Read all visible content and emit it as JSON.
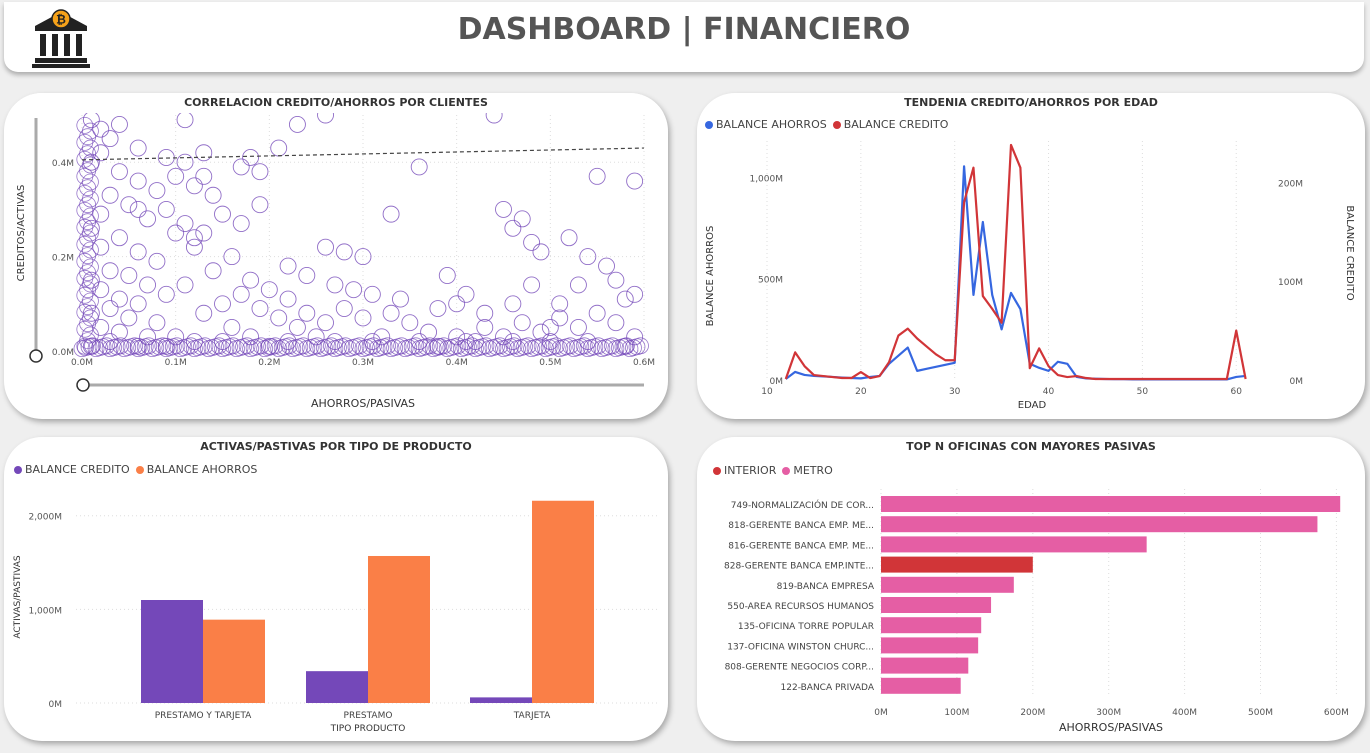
{
  "header": {
    "title": "DASHBOARD | FINANCIERO",
    "logo_icon": "bank-bitcoin-icon"
  },
  "colors": {
    "purple": "#7448b9",
    "orange": "#fa7f47",
    "blue": "#3667e0",
    "red": "#d13538",
    "pink": "#e55ea4",
    "darkred": "#d13538"
  },
  "panels": {
    "scatter": {
      "title": "CORRELACION CREDITO/AHORROS POR CLIENTES",
      "chart_data": {
        "type": "scatter",
        "xlabel": "AHORROS/PASIVAS",
        "ylabel": "CREDITOS/ACTIVAS",
        "xticks": [
          "0.0M",
          "0.1M",
          "0.2M",
          "0.3M",
          "0.4M",
          "0.5M",
          "0.6M"
        ],
        "yticks": [
          "0.0M",
          "0.2M",
          "0.4M"
        ],
        "xlim": [
          0,
          0.6
        ],
        "ylim": [
          0,
          0.5
        ],
        "trendline": {
          "x": [
            0,
            0.6
          ],
          "y": [
            0.405,
            0.43
          ]
        },
        "points": [
          [
            0.01,
            0.49
          ],
          [
            0.02,
            0.47
          ],
          [
            0.03,
            0.45
          ],
          [
            0.02,
            0.42
          ],
          [
            0.01,
            0.4
          ],
          [
            0.04,
            0.38
          ],
          [
            0.06,
            0.36
          ],
          [
            0.03,
            0.33
          ],
          [
            0.05,
            0.31
          ],
          [
            0.02,
            0.29
          ],
          [
            0.07,
            0.28
          ],
          [
            0.01,
            0.26
          ],
          [
            0.04,
            0.24
          ],
          [
            0.02,
            0.22
          ],
          [
            0.06,
            0.21
          ],
          [
            0.08,
            0.19
          ],
          [
            0.03,
            0.17
          ],
          [
            0.05,
            0.16
          ],
          [
            0.01,
            0.15
          ],
          [
            0.07,
            0.14
          ],
          [
            0.02,
            0.13
          ],
          [
            0.09,
            0.12
          ],
          [
            0.04,
            0.11
          ],
          [
            0.06,
            0.1
          ],
          [
            0.03,
            0.09
          ],
          [
            0.01,
            0.08
          ],
          [
            0.05,
            0.07
          ],
          [
            0.08,
            0.06
          ],
          [
            0.02,
            0.05
          ],
          [
            0.04,
            0.04
          ],
          [
            0.07,
            0.03
          ],
          [
            0.1,
            0.03
          ],
          [
            0.03,
            0.02
          ],
          [
            0.12,
            0.02
          ],
          [
            0.06,
            0.01
          ],
          [
            0.09,
            0.01
          ],
          [
            0.01,
            0.01
          ],
          [
            0.04,
            0.48
          ],
          [
            0.06,
            0.43
          ],
          [
            0.09,
            0.41
          ],
          [
            0.11,
            0.4
          ],
          [
            0.13,
            0.42
          ],
          [
            0.1,
            0.37
          ],
          [
            0.12,
            0.35
          ],
          [
            0.14,
            0.33
          ],
          [
            0.09,
            0.3
          ],
          [
            0.11,
            0.27
          ],
          [
            0.13,
            0.25
          ],
          [
            0.15,
            0.29
          ],
          [
            0.17,
            0.27
          ],
          [
            0.19,
            0.31
          ],
          [
            0.12,
            0.22
          ],
          [
            0.16,
            0.2
          ],
          [
            0.14,
            0.17
          ],
          [
            0.18,
            0.15
          ],
          [
            0.11,
            0.14
          ],
          [
            0.17,
            0.12
          ],
          [
            0.15,
            0.1
          ],
          [
            0.13,
            0.08
          ],
          [
            0.19,
            0.09
          ],
          [
            0.21,
            0.07
          ],
          [
            0.23,
            0.05
          ],
          [
            0.2,
            0.13
          ],
          [
            0.22,
            0.11
          ],
          [
            0.24,
            0.08
          ],
          [
            0.16,
            0.05
          ],
          [
            0.26,
            0.06
          ],
          [
            0.25,
            0.03
          ],
          [
            0.18,
            0.03
          ],
          [
            0.17,
            0.39
          ],
          [
            0.18,
            0.41
          ],
          [
            0.19,
            0.38
          ],
          [
            0.13,
            0.37
          ],
          [
            0.08,
            0.34
          ],
          [
            0.06,
            0.3
          ],
          [
            0.1,
            0.25
          ],
          [
            0.12,
            0.24
          ],
          [
            0.21,
            0.43
          ],
          [
            0.26,
            0.22
          ],
          [
            0.28,
            0.21
          ],
          [
            0.3,
            0.2
          ],
          [
            0.22,
            0.18
          ],
          [
            0.24,
            0.16
          ],
          [
            0.27,
            0.14
          ],
          [
            0.29,
            0.13
          ],
          [
            0.31,
            0.12
          ],
          [
            0.28,
            0.09
          ],
          [
            0.3,
            0.07
          ],
          [
            0.33,
            0.08
          ],
          [
            0.35,
            0.06
          ],
          [
            0.38,
            0.09
          ],
          [
            0.34,
            0.11
          ],
          [
            0.37,
            0.04
          ],
          [
            0.32,
            0.03
          ],
          [
            0.4,
            0.03
          ],
          [
            0.43,
            0.05
          ],
          [
            0.45,
            0.03
          ],
          [
            0.42,
            0.02
          ],
          [
            0.47,
            0.06
          ],
          [
            0.49,
            0.04
          ],
          [
            0.51,
            0.07
          ],
          [
            0.53,
            0.05
          ],
          [
            0.55,
            0.08
          ],
          [
            0.57,
            0.06
          ],
          [
            0.59,
            0.03
          ],
          [
            0.54,
            0.02
          ],
          [
            0.5,
            0.02
          ],
          [
            0.33,
            0.29
          ],
          [
            0.36,
            0.39
          ],
          [
            0.39,
            0.16
          ],
          [
            0.41,
            0.12
          ],
          [
            0.43,
            0.08
          ],
          [
            0.46,
            0.1
          ],
          [
            0.48,
            0.14
          ],
          [
            0.4,
            0.1
          ],
          [
            0.45,
            0.3
          ],
          [
            0.47,
            0.28
          ],
          [
            0.46,
            0.26
          ],
          [
            0.44,
            0.5
          ],
          [
            0.48,
            0.23
          ],
          [
            0.49,
            0.21
          ],
          [
            0.52,
            0.24
          ],
          [
            0.54,
            0.2
          ],
          [
            0.56,
            0.18
          ],
          [
            0.57,
            0.15
          ],
          [
            0.58,
            0.11
          ],
          [
            0.53,
            0.14
          ],
          [
            0.51,
            0.1
          ],
          [
            0.55,
            0.37
          ],
          [
            0.59,
            0.36
          ],
          [
            0.59,
            0.12
          ],
          [
            0.5,
            0.05
          ],
          [
            0.46,
            0.02
          ],
          [
            0.41,
            0.02
          ],
          [
            0.36,
            0.02
          ],
          [
            0.31,
            0.02
          ],
          [
            0.27,
            0.02
          ],
          [
            0.22,
            0.02
          ],
          [
            0.2,
            0.01
          ],
          [
            0.15,
            0.02
          ],
          [
            0.38,
            0.01
          ],
          [
            0.58,
            0.01
          ],
          [
            0.26,
            0.5
          ],
          [
            0.11,
            0.49
          ],
          [
            0.23,
            0.48
          ]
        ]
      },
      "slider_icon": "range-slider-handle-icon"
    },
    "trend": {
      "title": "TENDENIA CREDITO/AHORROS POR EDAD",
      "chart_data": {
        "type": "line",
        "xlabel": "EDAD",
        "ylabel_left": "BALANCE AHORROS",
        "ylabel_right": "BALANCE CREDITO",
        "xticks": [
          "10",
          "20",
          "30",
          "40",
          "50",
          "60"
        ],
        "yticks_left": [
          "0M",
          "500M",
          "1,000M"
        ],
        "yticks_right": [
          "0M",
          "100M",
          "200M"
        ],
        "xlim": [
          10,
          62
        ],
        "ylim_left": [
          0,
          1180
        ],
        "ylim_right": [
          0,
          242
        ],
        "series": [
          {
            "name": "BALANCE AHORROS",
            "axis": "left",
            "x": [
              12,
              13,
              14,
              15,
              16,
              17,
              18,
              19,
              20,
              21,
              22,
              23,
              24,
              25,
              26,
              27,
              28,
              29,
              30,
              31,
              32,
              33,
              34,
              35,
              36,
              37,
              38,
              39,
              40,
              41,
              42,
              43,
              44,
              45,
              46,
              47,
              48,
              49,
              50,
              51,
              52,
              53,
              54,
              55,
              56,
              57,
              58,
              59,
              60,
              61
            ],
            "y": [
              5,
              40,
              25,
              20,
              18,
              15,
              12,
              10,
              8,
              15,
              20,
              80,
              120,
              160,
              45,
              55,
              65,
              75,
              85,
              1055,
              420,
              780,
              420,
              250,
              430,
              350,
              80,
              60,
              45,
              90,
              80,
              15,
              8,
              6,
              5,
              4,
              4,
              3,
              3,
              3,
              3,
              3,
              3,
              3,
              3,
              3,
              3,
              3,
              15,
              20
            ]
          },
          {
            "name": "BALANCE CREDITO",
            "axis": "right",
            "x": [
              12,
              13,
              14,
              15,
              16,
              17,
              18,
              19,
              20,
              21,
              22,
              23,
              24,
              25,
              26,
              27,
              28,
              29,
              30,
              31,
              32,
              33,
              34,
              35,
              36,
              37,
              38,
              39,
              40,
              41,
              42,
              43,
              44,
              45,
              46,
              47,
              48,
              49,
              50,
              51,
              52,
              53,
              54,
              55,
              56,
              57,
              58,
              59,
              60,
              61
            ],
            "y": [
              1,
              28,
              14,
              5,
              4,
              3,
              2,
              2,
              8,
              2,
              4,
              18,
              45,
              52,
              42,
              34,
              26,
              20,
              20,
              180,
              215,
              85,
              72,
              58,
              238,
              215,
              12,
              32,
              14,
              5,
              3,
              4,
              2,
              1,
              1,
              1,
              1,
              1,
              1,
              1,
              1,
              1,
              1,
              1,
              1,
              1,
              1,
              1,
              50,
              1
            ]
          }
        ]
      }
    },
    "bars": {
      "title": "ACTIVAS/PASTIVAS POR TIPO DE PRODUCTO",
      "chart_data": {
        "type": "bar",
        "xlabel": "TIPO PRODUCTO",
        "ylabel": "ACTIVAS/PASTIVAS",
        "categories": [
          "PRESTAMO Y TARJETA",
          "PRESTAMO",
          "TARJETA"
        ],
        "yticks": [
          "0M",
          "1,000M",
          "2,000M"
        ],
        "ylim": [
          0,
          2200
        ],
        "series": [
          {
            "name": "BALANCE CREDITO",
            "values": [
              1100,
              340,
              60
            ]
          },
          {
            "name": "BALANCE AHORROS",
            "values": [
              890,
              1570,
              2160
            ]
          }
        ]
      }
    },
    "hbars": {
      "title": "TOP N OFICINAS CON MAYORES PASIVAS",
      "chart_data": {
        "type": "bar",
        "orientation": "horizontal",
        "xlabel": "AHORROS/PASIVAS",
        "legend": [
          "INTERIOR",
          "METRO"
        ],
        "xticks": [
          "0M",
          "100M",
          "200M",
          "300M",
          "400M",
          "500M",
          "600M"
        ],
        "xlim": [
          0,
          610
        ],
        "categories": [
          "749-NORMALIZACIÓN DE COR...",
          "818-GERENTE BANCA EMP. ME...",
          "816-GERENTE BANCA EMP. ME...",
          "828-GERENTE BANCA EMP.INTE...",
          "819-BANCA EMPRESA",
          "550-AREA RECURSOS HUMANOS",
          "135-OFICINA TORRE POPULAR",
          "137-OFICINA WINSTON CHURC...",
          "808-GERENTE NEGOCIOS CORP...",
          "122-BANCA PRIVADA"
        ],
        "values": [
          605,
          575,
          350,
          200,
          175,
          145,
          132,
          128,
          115,
          105
        ],
        "groups": [
          "METRO",
          "METRO",
          "METRO",
          "INTERIOR",
          "METRO",
          "METRO",
          "METRO",
          "METRO",
          "METRO",
          "METRO"
        ]
      }
    }
  }
}
